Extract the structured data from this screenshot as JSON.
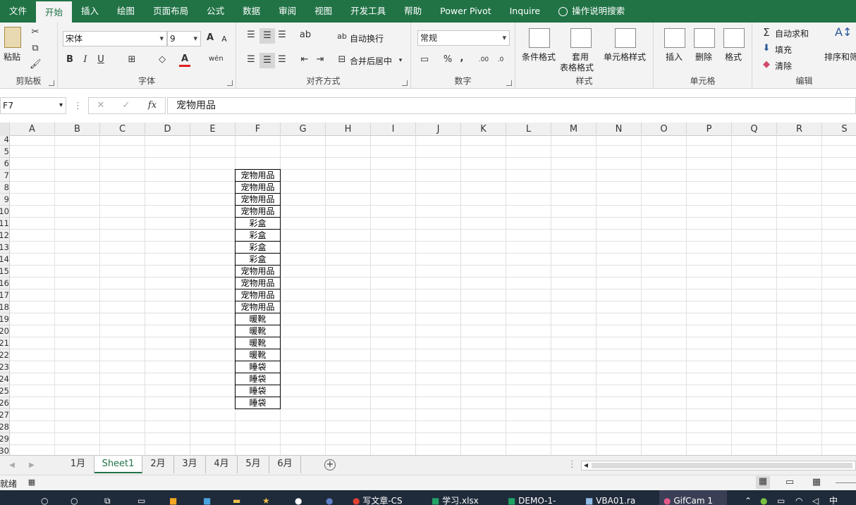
{
  "menu": {
    "tabs": [
      "文件",
      "开始",
      "插入",
      "绘图",
      "页面布局",
      "公式",
      "数据",
      "审阅",
      "视图",
      "开发工具",
      "帮助",
      "Power Pivot",
      "Inquire"
    ],
    "active": "开始",
    "tell_me": "操作说明搜索"
  },
  "ribbon": {
    "clipboard": {
      "paste": "粘贴",
      "label": "剪贴板"
    },
    "font": {
      "family": "宋体",
      "size": "9",
      "bold": "B",
      "italic": "I",
      "underline": "U",
      "label": "字体"
    },
    "alignment": {
      "wrap": "自动换行",
      "merge": "合并后居中",
      "label": "对齐方式"
    },
    "number": {
      "format": "常规",
      "percent": "%",
      "comma": ",",
      "label": "数字"
    },
    "styles": {
      "conditional": "条件格式",
      "table1": "套用",
      "table2": "表格格式",
      "cell_styles": "单元格样式",
      "label": "样式"
    },
    "cells": {
      "insert": "插入",
      "delete": "删除",
      "format": "格式",
      "label": "单元格"
    },
    "editing": {
      "autosum": "自动求和",
      "fill": "填充",
      "clear": "清除",
      "sort": "排序和筛",
      "label": "编辑"
    }
  },
  "formula_bar": {
    "name_box": "F7",
    "fx": "fx",
    "content": "宠物用品"
  },
  "columns": [
    "A",
    "B",
    "C",
    "D",
    "E",
    "F",
    "G",
    "H",
    "I",
    "J",
    "K",
    "L",
    "M",
    "N",
    "O",
    "P",
    "Q",
    "R",
    "S"
  ],
  "rows": [
    "4",
    "5",
    "6",
    "7",
    "8",
    "9",
    "10",
    "11",
    "12",
    "13",
    "14",
    "15",
    "16",
    "17",
    "18",
    "19",
    "20",
    "21",
    "22",
    "23",
    "24",
    "25",
    "26",
    "27",
    "28",
    "29",
    "30"
  ],
  "column_f_values": [
    "宠物用品",
    "宠物用品",
    "宠物用品",
    "宠物用品",
    "彩盒",
    "彩盒",
    "彩盒",
    "彩盒",
    "宠物用品",
    "宠物用品",
    "宠物用品",
    "宠物用品",
    "暖靴",
    "暖靴",
    "暖靴",
    "暖靴",
    "睡袋",
    "睡袋",
    "睡袋",
    "睡袋"
  ],
  "sheet_tabs": [
    "1月",
    "Sheet1",
    "2月",
    "3月",
    "4月",
    "5月",
    "6月"
  ],
  "active_sheet": "Sheet1",
  "status": {
    "ready": "就绪"
  },
  "taskbar": {
    "items": [
      "写文章-CS",
      "学习.xlsx",
      "DEMO-1-",
      "VBA01.ra",
      "GifCam 1"
    ]
  }
}
